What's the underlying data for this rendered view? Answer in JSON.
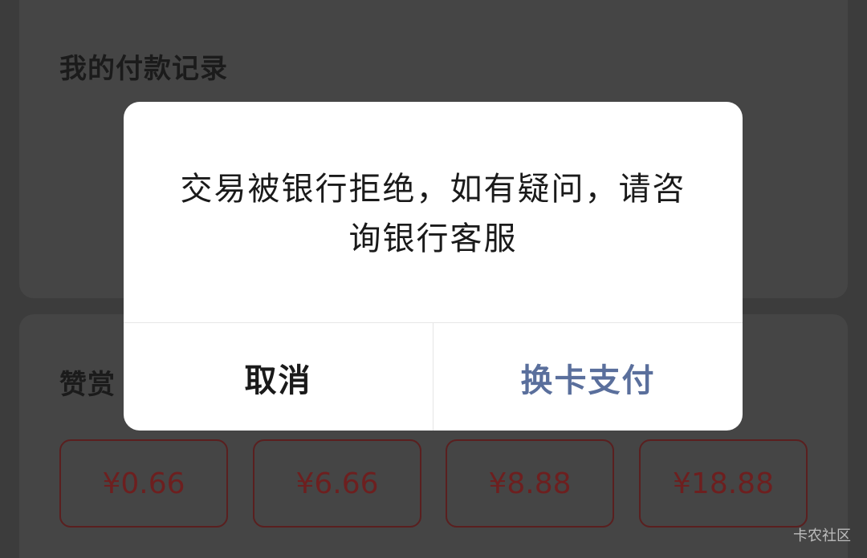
{
  "background": {
    "records_title": "我的付款记录",
    "reward_title": "赞赏",
    "reward_amounts": [
      "¥0.66",
      "¥6.66",
      "¥8.88",
      "¥18.88"
    ]
  },
  "dialog": {
    "message": "交易被银行拒绝，如有疑问，请咨询银行客服",
    "cancel_label": "取消",
    "confirm_label": "换卡支付"
  },
  "watermark": "卡农社区",
  "colors": {
    "overlay": "#3c3c3c",
    "dialog_bg": "#ffffff",
    "confirm_text": "#5a6f9c",
    "amount_text": "#6d1f1f"
  }
}
